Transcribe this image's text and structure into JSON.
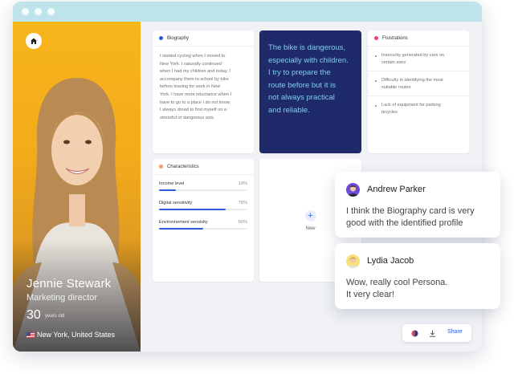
{
  "profile": {
    "name": "Jennie Stewark",
    "role": "Marketing director",
    "age": "30",
    "age_unit": "years old",
    "location": "New York, United States"
  },
  "biography": {
    "title": "Biography",
    "lines": [
      "I started cycling when I moved to",
      "New York. I naturally continued",
      "when I had my children and today, I",
      "accompany them to school by bike",
      "before leaving for work in New",
      "York. I have more reluctance when I",
      "have to go to a place I do not know.",
      "I always dread to find myself on a",
      "stressful or dangerous axis."
    ]
  },
  "quote": {
    "lines": [
      "The bike is dangerous,",
      "especially with children.",
      "I try to prepare the",
      "route before but it is",
      "not always practical",
      "and reliable."
    ]
  },
  "frustrations": {
    "title": "Frustrations",
    "items": [
      {
        "line1": "Insecurity generated by cars on",
        "line2": "certain axes"
      },
      {
        "line1": "Difficulty in identifying the most",
        "line2": "suitable routes"
      },
      {
        "line1": "Lack of equipment for parking",
        "line2": "bicycles"
      }
    ]
  },
  "characteristics": {
    "title": "Characteristics",
    "items": [
      {
        "label": "Income level",
        "value": "19%",
        "level": 0.19
      },
      {
        "label": "Digital sensitivity",
        "value": "75%",
        "level": 0.75
      },
      {
        "label": "Environnement sensivity",
        "value": "50%",
        "level": 0.5
      }
    ]
  },
  "new_card": {
    "label": "New",
    "plus": "+"
  },
  "comments": [
    {
      "author": "Andrew Parker",
      "line1": "I think the Biography card is very",
      "line2": "good with the identified profile"
    },
    {
      "author": "Lydia Jacob",
      "line1": "Wow, really cool Persona.",
      "line2": "It very clear!"
    }
  ],
  "toolbar": {
    "share_label": "Share"
  },
  "colors": {
    "accent": "#2c5bd8",
    "quote_bg": "#1f2a6b",
    "quote_text": "#7fd0ea",
    "profile_bg": "#f7b51c",
    "biography_dot": "#2c5bd8",
    "frustrations_dot": "#f0446b",
    "characteristics_dot": "#f29d6b"
  },
  "icons": {
    "home": "home-icon",
    "plus": "plus-icon",
    "palette": "palette-icon",
    "download": "download-icon",
    "flag": "us-flag-icon"
  }
}
